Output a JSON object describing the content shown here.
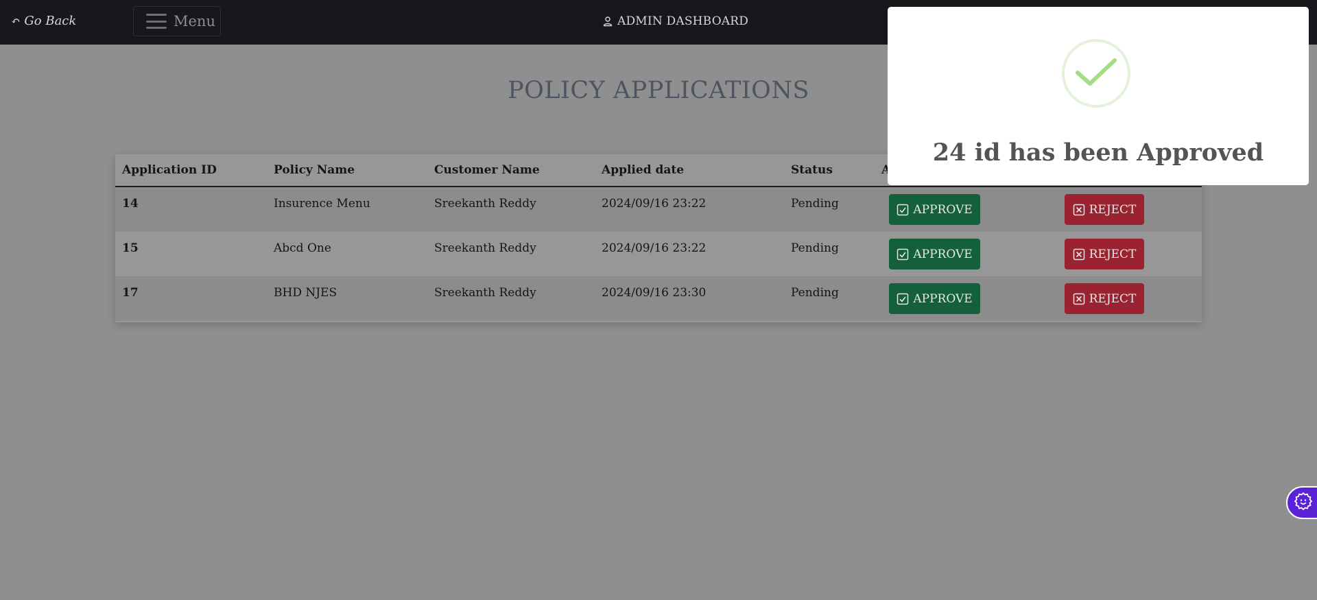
{
  "navbar": {
    "go_back_label": "Go Back",
    "menu_label": "Menu",
    "dashboard_title": "ADMIN DASHBOARD"
  },
  "page": {
    "heading": "POLICY APPLICATIONS"
  },
  "table": {
    "columns": [
      "Application ID",
      "Policy Name",
      "Customer Name",
      "Applied date",
      "Status",
      "A"
    ],
    "rows": [
      {
        "id": "14",
        "policy": "Insurence Menu",
        "customer": "Sreekanth Reddy",
        "date": "2024/09/16 23:22",
        "status": "Pending"
      },
      {
        "id": "15",
        "policy": "Abcd One",
        "customer": "Sreekanth Reddy",
        "date": "2024/09/16 23:22",
        "status": "Pending"
      },
      {
        "id": "17",
        "policy": "BHD NJES",
        "customer": "Sreekanth Reddy",
        "date": "2024/09/16 23:30",
        "status": "Pending"
      }
    ],
    "approve_label": "APPROVE",
    "reject_label": "REJECT"
  },
  "toast": {
    "message": "24 id has been Approved",
    "icon": "check-icon"
  },
  "colors": {
    "navbar": "#17181c",
    "approve": "#13603a",
    "reject": "#9b2331",
    "success": "#a5dc86",
    "fab": "#5b21d6"
  }
}
